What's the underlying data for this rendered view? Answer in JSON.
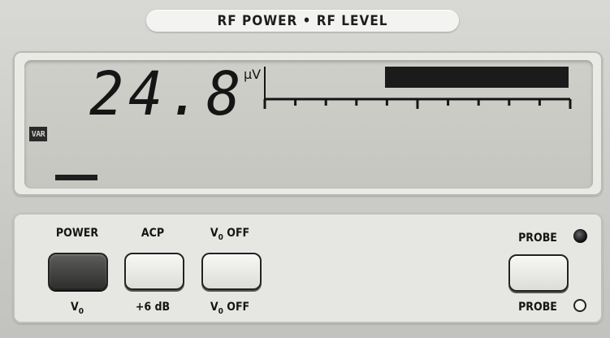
{
  "title": "RF POWER • RF LEVEL",
  "display": {
    "reading": "24.8",
    "unit": "μV",
    "annunciator": "VAR",
    "bargraph_fill_fraction": 0.58
  },
  "buttons": [
    {
      "id": "power",
      "top_label": "POWER",
      "bottom_label": "V",
      "bottom_sub": "0",
      "style": "dark"
    },
    {
      "id": "acp",
      "top_label": "ACP",
      "bottom_label": "+6 dB",
      "style": "light"
    },
    {
      "id": "vo-off",
      "top_label": "V",
      "top_sub": "0",
      "top_suffix": " OFF",
      "bottom_label": "V",
      "bottom_sub": "0",
      "bottom_suffix": " OFF",
      "style": "light"
    },
    {
      "id": "probe",
      "top_label": "PROBE",
      "bottom_label": "PROBE",
      "style": "light"
    }
  ],
  "indicators": {
    "probe_upper": "on",
    "probe_lower": "off"
  }
}
